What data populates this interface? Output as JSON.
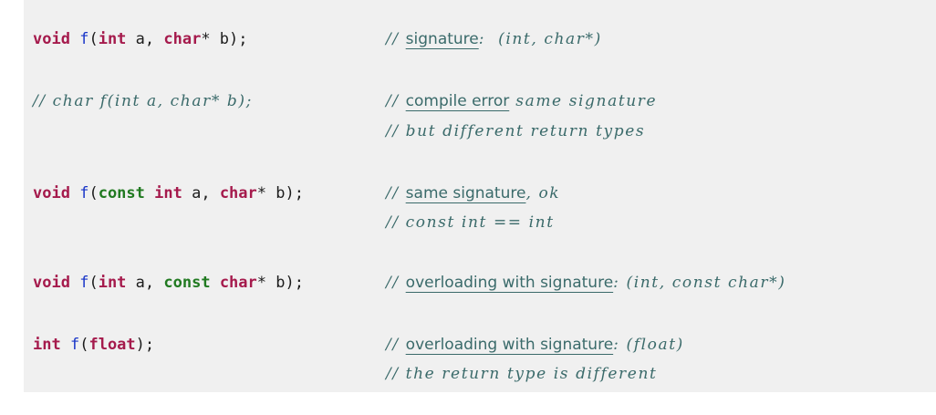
{
  "code": {
    "line1": {
      "ret": "void",
      "fn": "f",
      "p1": "(",
      "t1": "int",
      "p2": " a, ",
      "t2": "char",
      "p3": "* b);",
      "c_prefix": "// ",
      "c_ul": "signature",
      "c_rest": ":  (int, char*)"
    },
    "line2": {
      "code": "// char f(int a, char* b);",
      "c_prefix": "// ",
      "c_ul": "compile error",
      "c_rest": " same signature"
    },
    "line3": {
      "comment": "// but different return types"
    },
    "line4": {
      "ret": "void",
      "fn": "f",
      "p1": "(",
      "k1": "const",
      "sp1": " ",
      "t1": "int",
      "p2": " a, ",
      "t2": "char",
      "p3": "* b);",
      "c_prefix": "// ",
      "c_ul": "same signature",
      "c_rest": ", ok"
    },
    "line5": {
      "comment": "// const int == int"
    },
    "line6": {
      "ret": "void",
      "fn": "f",
      "p1": "(",
      "t1": "int",
      "p2": " a, ",
      "k1": "const",
      "sp1": " ",
      "t2": "char",
      "p3": "* b);",
      "c_prefix": "// ",
      "c_ul": "overloading with signature",
      "c_rest": ": (int, const char*)"
    },
    "line7": {
      "ret": "int",
      "fn": "f",
      "p1": "(",
      "t1": "float",
      "p2": ");",
      "c_prefix": "// ",
      "c_ul": "overloading with signature",
      "c_rest": ": (float)"
    },
    "line8": {
      "comment": "// the return type is different"
    }
  },
  "colors": {
    "type_keyword": "#a51a4c",
    "const_keyword": "#217a21",
    "function_name": "#1a36c8",
    "comment": "#3a6a6a",
    "background": "#f0f0f0"
  }
}
